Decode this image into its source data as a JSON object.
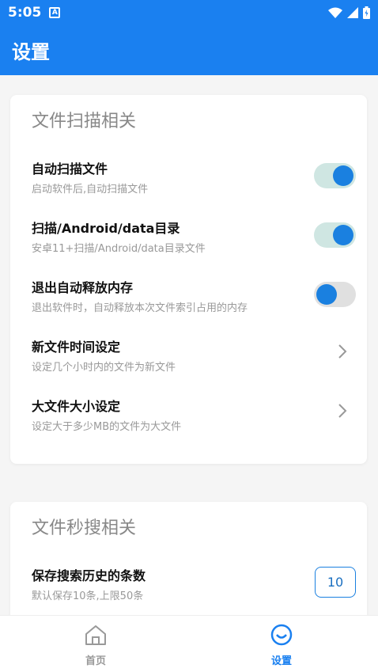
{
  "status": {
    "time": "5:05",
    "notification_icon": "A"
  },
  "appbar": {
    "title": "设置"
  },
  "section1": {
    "title": "文件扫描相关",
    "items": [
      {
        "title": "自动扫描文件",
        "subtitle": "启动软件后,自动扫描文件",
        "control": "switch",
        "enabled": true
      },
      {
        "title": "扫描/Android/data目录",
        "subtitle": "安卓11+扫描/Android/data目录文件",
        "control": "switch",
        "enabled": true
      },
      {
        "title": "退出自动释放内存",
        "subtitle": "退出软件时，自动释放本次文件索引占用的内存",
        "control": "switch",
        "enabled": false
      },
      {
        "title": "新文件时间设定",
        "subtitle": "设定几个小时内的文件为新文件",
        "control": "chevron"
      },
      {
        "title": "大文件大小设定",
        "subtitle": "设定大于多少MB的文件为大文件",
        "control": "chevron"
      }
    ]
  },
  "section2": {
    "title": "文件秒搜相关",
    "items": [
      {
        "title": "保存搜索历史的条数",
        "subtitle": "默认保存10条,上限50条",
        "value": "10"
      }
    ]
  },
  "bottom_nav": {
    "items": [
      {
        "label": "首页",
        "icon": "home-icon",
        "active": false
      },
      {
        "label": "设置",
        "icon": "smiley-icon",
        "active": true
      }
    ]
  },
  "colors": {
    "primary": "#1a80f0",
    "switch_track_on": "#cfe6e2",
    "switch_knob": "#1a80e0"
  }
}
